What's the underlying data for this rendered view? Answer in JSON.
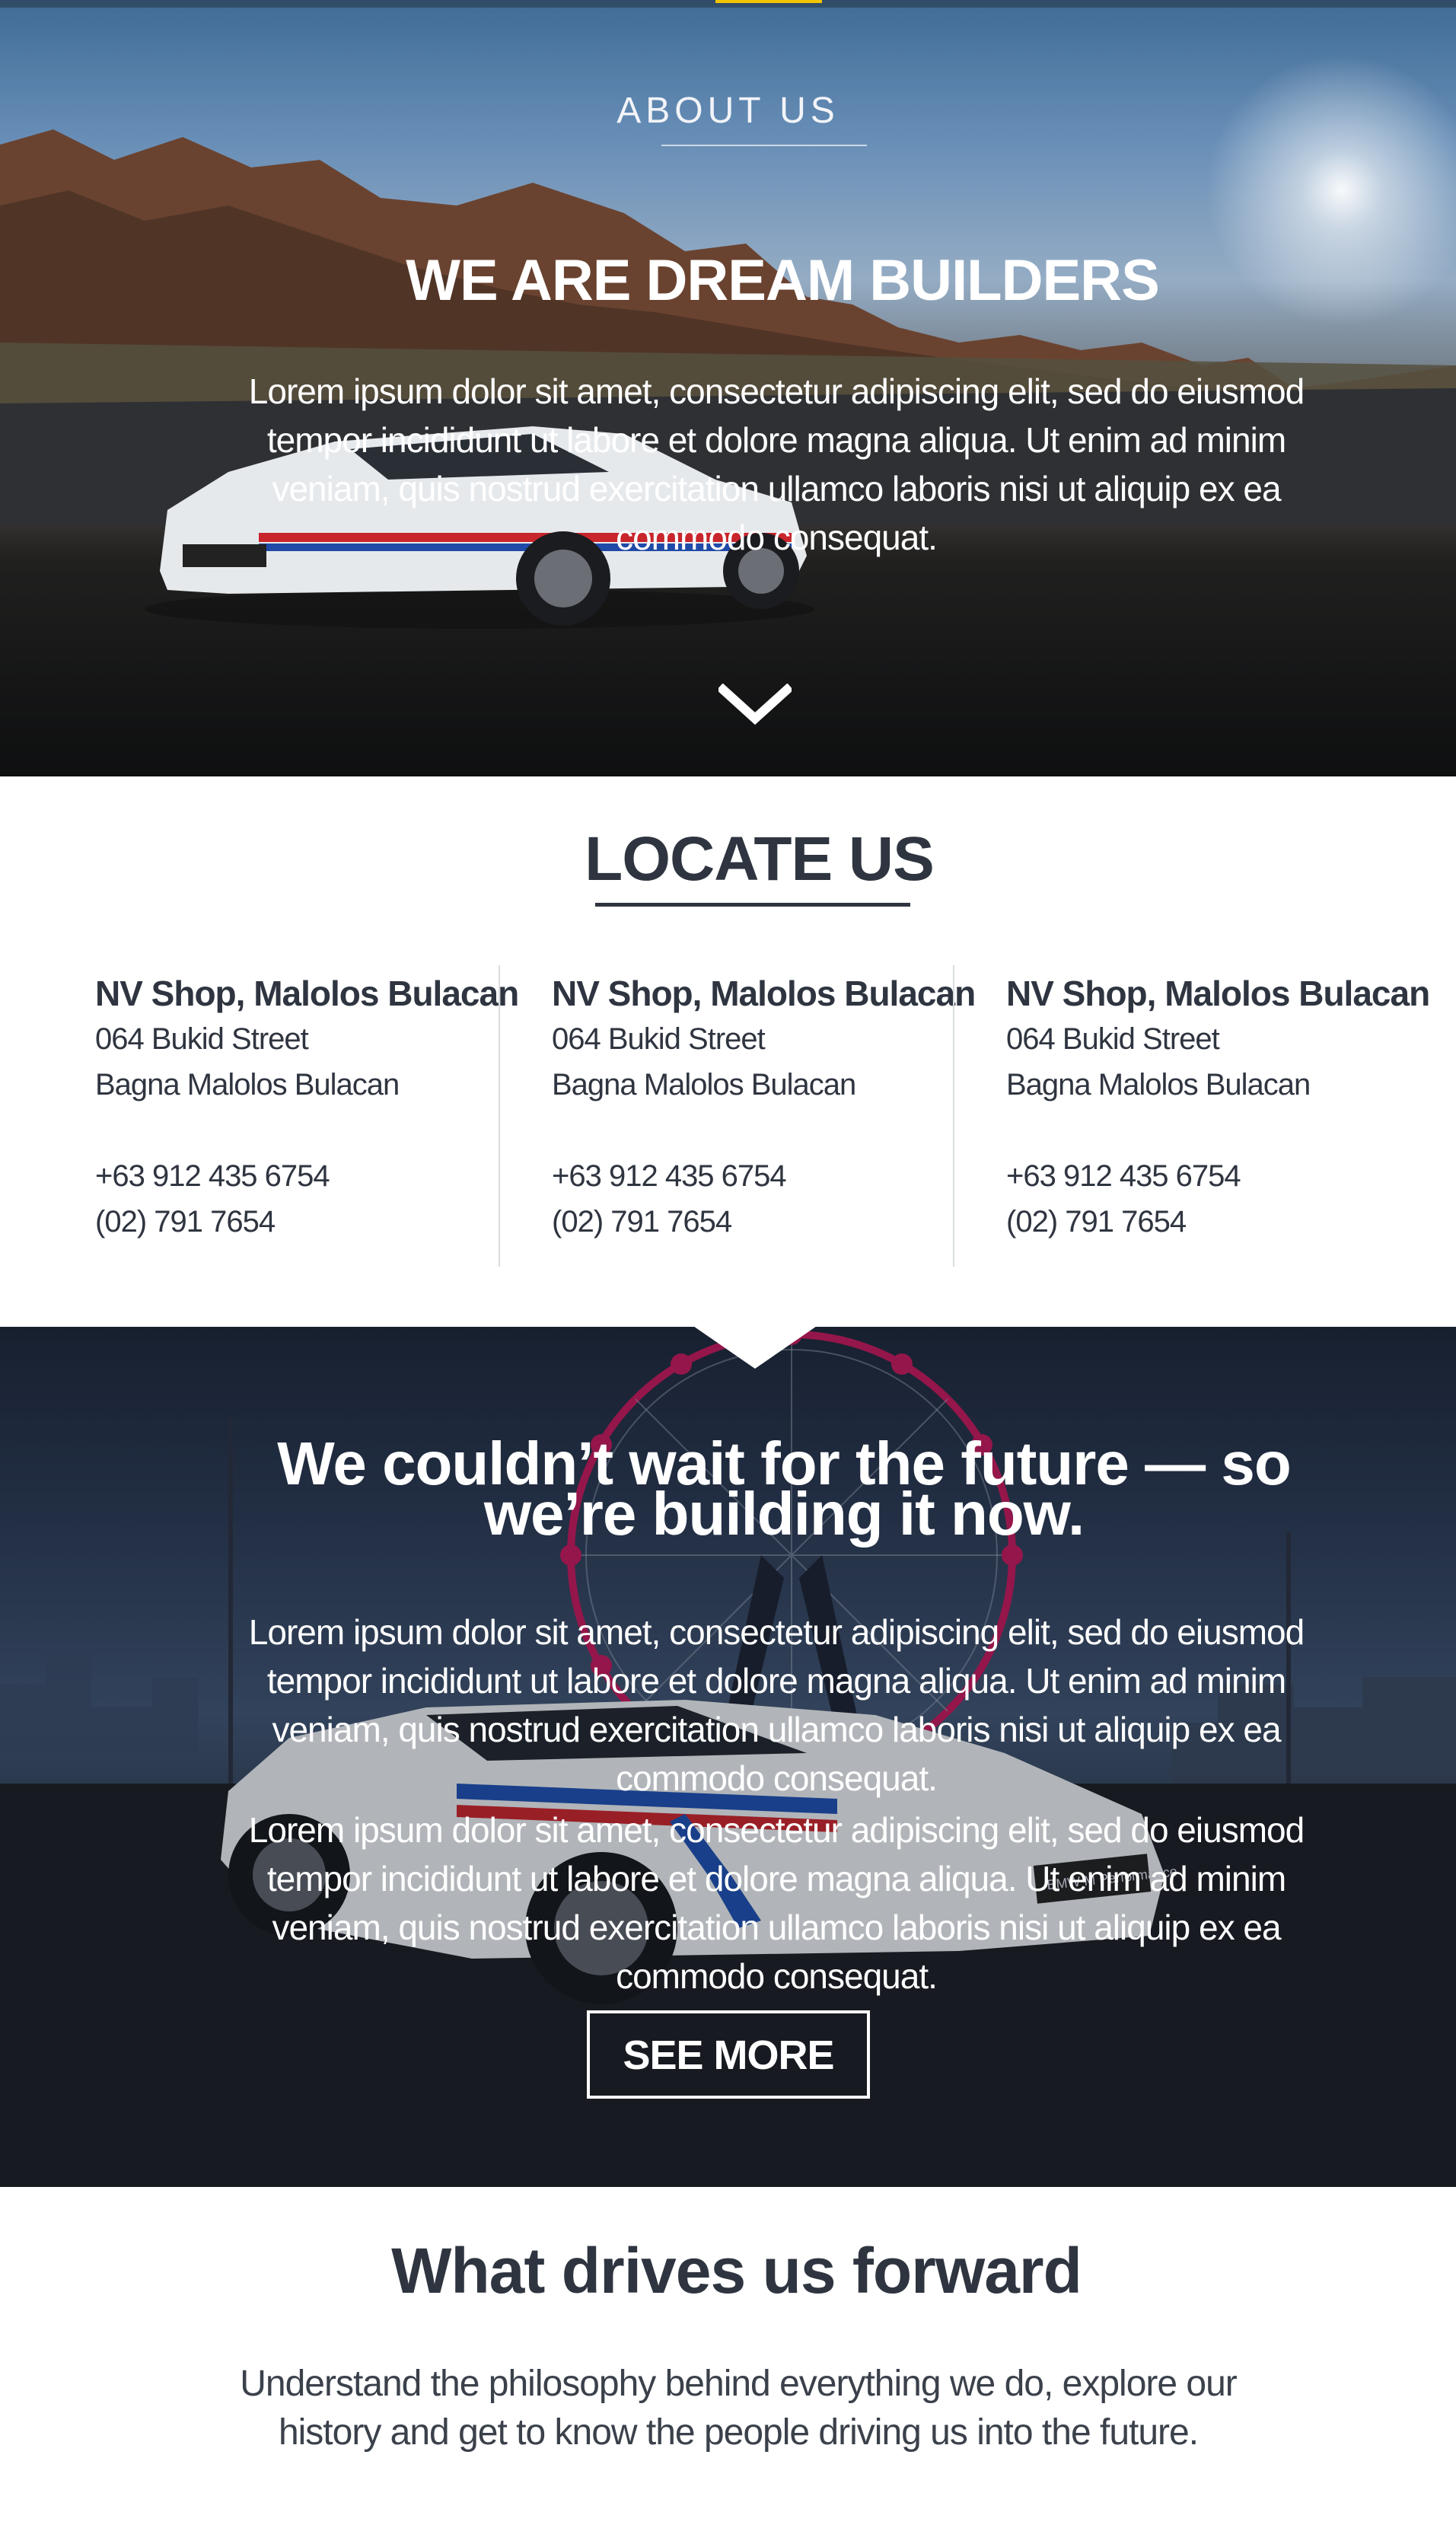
{
  "hero": {
    "label": "ABOUT US",
    "title": "WE ARE DREAM BUILDERS",
    "paragraph": "Lorem ipsum dolor sit amet, consectetur adipiscing elit, sed do eiusmod tempor incididunt ut labore et dolore magna aliqua. Ut enim ad minim veniam, quis nostrud exercitation ullamco laboris nisi ut aliquip ex ea commodo consequat."
  },
  "locate": {
    "title": "LOCATE US",
    "shops": [
      {
        "name": "NV Shop, Malolos Bulacan",
        "street": "064 Bukid Street",
        "city": "Bagna Malolos Bulacan",
        "mobile": "+63 912 435 6754",
        "landline": "(02) 791 7654"
      },
      {
        "name": "NV Shop, Malolos Bulacan",
        "street": "064 Bukid Street",
        "city": "Bagna Malolos Bulacan",
        "mobile": "+63 912 435 6754",
        "landline": "(02) 791 7654"
      },
      {
        "name": "NV Shop, Malolos Bulacan",
        "street": "064 Bukid Street",
        "city": "Bagna Malolos Bulacan",
        "mobile": "+63 912 435 6754",
        "landline": "(02) 791 7654"
      }
    ]
  },
  "future": {
    "title": "We couldn’t wait for the future — so we’re building it now.",
    "paragraph_1": "Lorem ipsum dolor sit amet, consectetur adipiscing elit, sed do eiusmod tempor incididunt ut labore et dolore magna aliqua. Ut enim ad minim veniam, quis nostrud exercitation ullamco laboris nisi ut aliquip ex ea commodo consequat.",
    "paragraph_2": "Lorem ipsum dolor sit amet, consectetur adipiscing elit, sed do eiusmod tempor incididunt ut labore et dolore magna aliqua. Ut enim ad minim veniam, quis nostrud exercitation ullamco laboris nisi ut aliquip ex ea commodo consequat.",
    "button": "SEE MORE",
    "plate_text": "BMW M Performance"
  },
  "drives": {
    "title": "What drives us forward",
    "paragraph": "Understand the philosophy behind everything we do, explore our history and get to know the people driving us into the future."
  },
  "icons": {
    "scroll": "chevron-down-icon"
  },
  "colors": {
    "accent": "#f2c400",
    "text_dark": "#2f3540",
    "hero_overlay_text": "#ffffff",
    "divider": "#d9dce0"
  }
}
